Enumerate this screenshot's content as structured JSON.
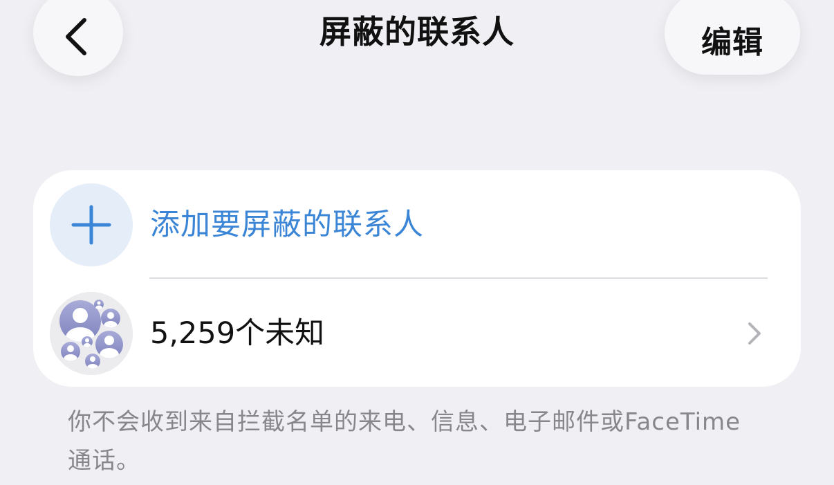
{
  "header": {
    "back_icon": "chevron-left-icon",
    "title": "屏蔽的联系人",
    "edit_label": "编辑"
  },
  "card": {
    "add_row": {
      "icon": "plus-icon",
      "label": "添加要屏蔽的联系人"
    },
    "unknown_row": {
      "icon": "contacts-group-avatar-icon",
      "label": "5,259个未知",
      "chevron": "chevron-right-icon"
    }
  },
  "footer": {
    "note": "你不会收到来自拦截名单的来电、信息、电子邮件或FaceTime通话。"
  },
  "colors": {
    "background": "#efeff4",
    "card": "#ffffff",
    "accent": "#3a85d6",
    "add_circle": "#e4edf8",
    "secondary_text": "#86868b",
    "avatar_purple": "#8e92c6"
  }
}
